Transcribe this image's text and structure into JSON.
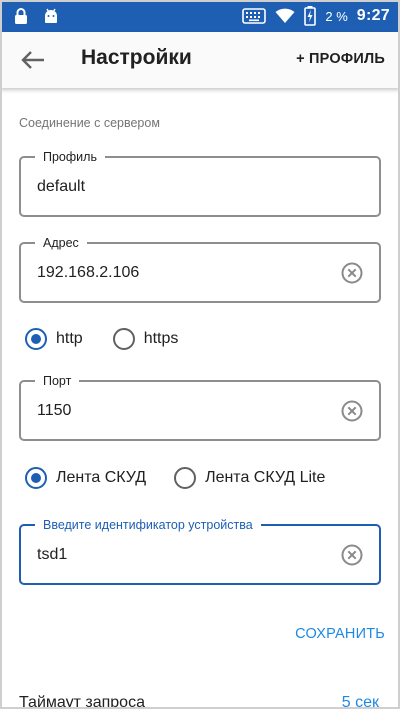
{
  "status_bar": {
    "battery_percent": "2 %",
    "time": "9:27",
    "icons": [
      "lock-icon",
      "android-icon",
      "keyboard-icon",
      "wifi-icon",
      "battery-charging-icon"
    ]
  },
  "app_bar": {
    "title": "Настройки",
    "add_profile_label": "+ ПРОФИЛЬ",
    "back_icon": "arrow-left-icon"
  },
  "connection": {
    "section_label": "Соединение с сервером",
    "profile": {
      "label": "Профиль",
      "value": "default"
    },
    "address": {
      "label": "Адрес",
      "value": "192.168.2.106"
    },
    "protocol": {
      "options": [
        "http",
        "https"
      ],
      "selected": "http"
    },
    "port": {
      "label": "Порт",
      "value": "1150"
    },
    "mode": {
      "options": [
        "Лента СКУД",
        "Лента СКУД Lite"
      ],
      "selected": "Лента СКУД"
    },
    "device_id": {
      "label": "Введите идентификатор устройства",
      "value": "tsd1"
    },
    "save_label": "СОХРАНИТЬ"
  },
  "timeout": {
    "label": "Таймаут запроса",
    "value": "5 сек"
  },
  "colors": {
    "primary": "#1e5fb4",
    "accent": "#1e88e5",
    "border": "#8e8e8e"
  }
}
